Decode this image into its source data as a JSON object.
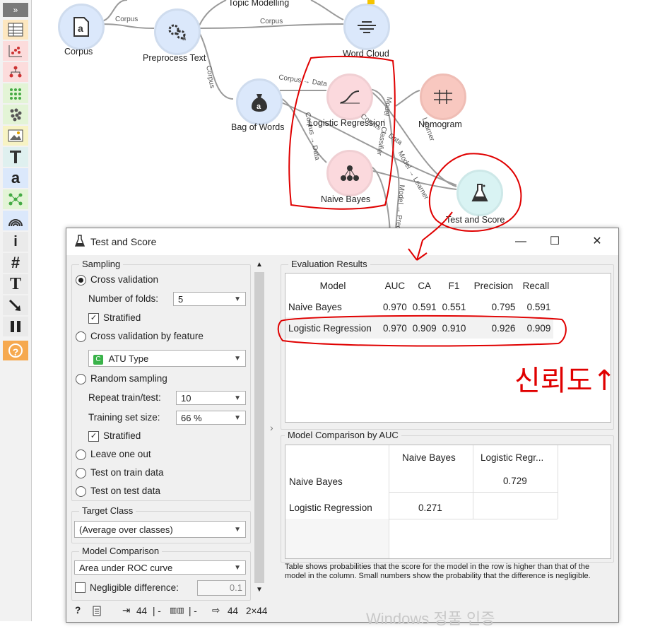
{
  "toolbar": {
    "expand_label": "»",
    "icons": [
      "table-icon",
      "scatter-plot-icon",
      "tree-icon",
      "grid-icon",
      "dots-icon",
      "image-icon",
      "text-t-icon",
      "a-text-icon",
      "network-icon",
      "signal-icon",
      "info-icon",
      "hash-icon",
      "big-t-icon",
      "arrow-icon",
      "pause-icon",
      "help-icon"
    ],
    "info_glyph": "i",
    "hash_glyph": "#",
    "t_glyph": "T",
    "a_glyph": "a",
    "help_glyph": "?"
  },
  "canvas": {
    "nodes": {
      "corpus": "Corpus",
      "preprocess": "Preprocess Text",
      "topic": "Topic Modelling",
      "wordcloud": "Word Cloud",
      "bow": "Bag of Words",
      "logreg": "Logistic Regression",
      "nomogram": "Nomogram",
      "naivebayes": "Naive Bayes",
      "testscore": "Test and Score"
    },
    "edges": {
      "e1": "Corpus",
      "e2": "Corpus",
      "e3": "Corpus",
      "e4": "Corpus → Data",
      "e5": "Corpus → Data",
      "e6": "Model → Classifier",
      "e7": "Learner",
      "e8": "Corpus → Data",
      "e9": "Model → Learner",
      "e10": "Model → Predictors"
    },
    "colors": {
      "blue": "#dbe8fb",
      "pink": "#fbd9dd",
      "salmon": "#f8c8c0",
      "cyan": "#d9f3f3"
    }
  },
  "dialog": {
    "title": "Test and Score",
    "sampling": {
      "title": "Sampling",
      "cross_validation": "Cross validation",
      "folds_label": "Number of folds:",
      "folds_value": "5",
      "stratified1": "Stratified",
      "cv_by_feature": "Cross validation by feature",
      "feature_value": "ATU Type",
      "feature_badge": "C",
      "random_sampling": "Random sampling",
      "repeat_label": "Repeat train/test:",
      "repeat_value": "10",
      "train_size_label": "Training set size:",
      "train_size_value": "66 %",
      "stratified2": "Stratified",
      "leave_one_out": "Leave one out",
      "test_on_train": "Test on train data",
      "test_on_test": "Test on test data"
    },
    "target": {
      "title": "Target Class",
      "value": "(Average over classes)"
    },
    "comparison": {
      "title": "Model Comparison",
      "value": "Area under ROC curve",
      "negligible_label": "Negligible difference:",
      "negligible_value": "0.1"
    },
    "results": {
      "title": "Evaluation Results",
      "headers": [
        "Model",
        "AUC",
        "CA",
        "F1",
        "Precision",
        "Recall"
      ],
      "rows": [
        [
          "Naive Bayes",
          "0.970",
          "0.591",
          "0.551",
          "0.795",
          "0.591"
        ],
        [
          "Logistic Regression",
          "0.970",
          "0.909",
          "0.910",
          "0.926",
          "0.909"
        ]
      ]
    },
    "auc_comparison": {
      "title": "Model Comparison by AUC",
      "col1": "Naive Bayes",
      "col2": "Logistic Regr...",
      "row1": "Naive Bayes",
      "row2": "Logistic Regression",
      "r1c2": "0.729",
      "r2c1": "0.271"
    },
    "note": "Table shows probabilities that the score for the model in the row is higher than that of the model in the column. Small numbers show the probability that the difference is negligible.",
    "statusbar": {
      "help": "?",
      "input_count": "44",
      "sep1": "| -",
      "sep2": "| -",
      "output_count": "44",
      "dims": "2×44"
    }
  },
  "annotation": {
    "handwriting": "신뢰도↑"
  },
  "watermark": "Windows 정품 인증"
}
